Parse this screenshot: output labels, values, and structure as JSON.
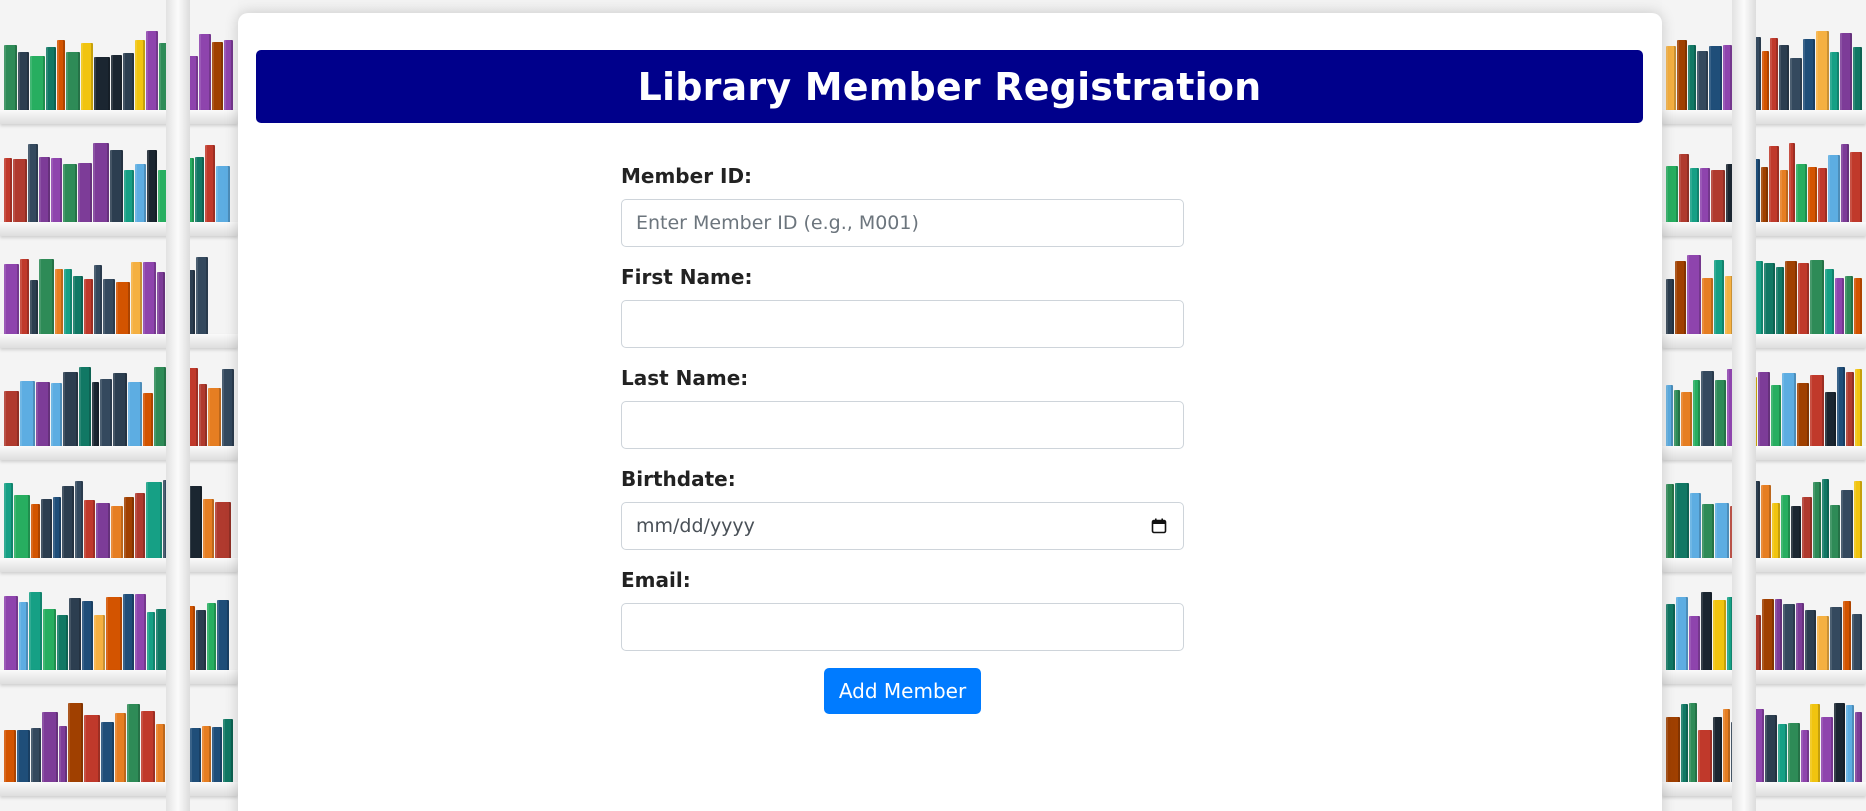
{
  "header": {
    "title": "Library Member Registration"
  },
  "form": {
    "member_id": {
      "label": "Member ID:",
      "placeholder": "Enter Member ID (e.g., M001)",
      "value": ""
    },
    "first_name": {
      "label": "First Name:",
      "value": ""
    },
    "last_name": {
      "label": "Last Name:",
      "value": ""
    },
    "birthdate": {
      "label": "Birthdate:",
      "placeholder": "mm/dd/yyyy"
    },
    "email": {
      "label": "Email:",
      "value": ""
    },
    "submit_label": "Add Member"
  },
  "colors": {
    "header_bg": "#00008b",
    "button_bg": "#007bff",
    "card_bg": "#ffffff"
  },
  "icons": {
    "birthdate_picker": "calendar-icon"
  }
}
